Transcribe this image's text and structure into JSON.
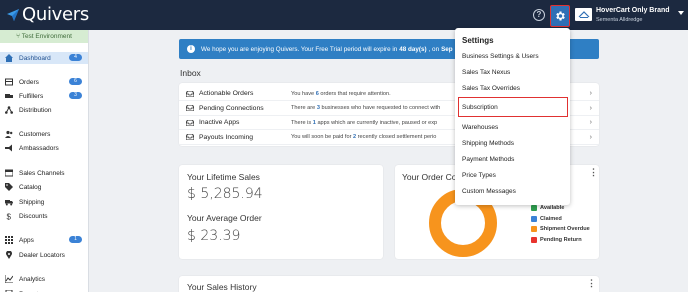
{
  "app": {
    "logo_text": "Quivers",
    "brand_name": "HoverCart Only Brand",
    "user_name": "Sementa Alldredge"
  },
  "sidebar": {
    "environment": "Test Environment",
    "items": [
      {
        "label": "Dashboard",
        "badge": "4",
        "icon": "home-icon",
        "active": true
      },
      {
        "label": "Orders",
        "badge": "6",
        "icon": "orders-icon"
      },
      {
        "label": "Fulfillers",
        "badge": "3",
        "icon": "fulfillers-icon"
      },
      {
        "label": "Distribution",
        "badge": "",
        "icon": "distribution-icon"
      },
      {
        "label": "Customers",
        "badge": "",
        "icon": "customers-icon"
      },
      {
        "label": "Ambassadors",
        "badge": "",
        "icon": "megaphone-icon"
      },
      {
        "label": "Sales Channels",
        "badge": "",
        "icon": "sales-channels-icon"
      },
      {
        "label": "Catalog",
        "badge": "",
        "icon": "tag-icon"
      },
      {
        "label": "Shipping",
        "badge": "",
        "icon": "truck-icon"
      },
      {
        "label": "Discounts",
        "badge": "",
        "icon": "dollar-icon"
      },
      {
        "label": "Apps",
        "badge": "1",
        "icon": "grid-icon"
      },
      {
        "label": "Dealer Locators",
        "badge": "",
        "icon": "map-pin-icon"
      },
      {
        "label": "Analytics",
        "badge": "",
        "icon": "chart-icon"
      },
      {
        "label": "Reports",
        "badge": "",
        "icon": "reports-icon"
      }
    ]
  },
  "banner": {
    "text_before": "We hope you are enjoying Quivers. Your Free Trial period will expire in",
    "days": "48 day(s)",
    "text_after": ", on",
    "date_partial": "Sep"
  },
  "inbox": {
    "title": "Inbox",
    "rows": [
      {
        "label": "Actionable Orders",
        "pre": "You have",
        "num": "6",
        "post": "orders that require attention."
      },
      {
        "label": "Pending Connections",
        "pre": "There are",
        "num": "3",
        "post": "businesses who have requested to connect with"
      },
      {
        "label": "Inactive Apps",
        "pre": "There is",
        "num": "1",
        "post": "apps which are currently inactive, paused or exp"
      },
      {
        "label": "Payouts Incoming",
        "pre": "You will soon be paid for",
        "num": "2",
        "post": "recently closed settlement perio"
      }
    ]
  },
  "lifetime": {
    "title": "Your Lifetime Sales",
    "value": "$ 5,285.94",
    "avg_title": "Your Average Order",
    "avg_value": "$ 23.39"
  },
  "order_card": {
    "title_partial": "Your Order Co",
    "legend": [
      {
        "label": "Available",
        "color": "#2e9e4f"
      },
      {
        "label": "Claimed",
        "color": "#3b82d6"
      },
      {
        "label": "Shipment Overdue",
        "color": "#f7941d"
      },
      {
        "label": "Pending Return",
        "color": "#e8332d"
      }
    ],
    "donut_color": "#f7941d"
  },
  "sales_history": {
    "title": "Your Sales History"
  },
  "settings_menu": {
    "heading": "Settings",
    "items": [
      "Business Settings & Users",
      "Sales Tax Nexus",
      "Sales Tax Overrides",
      "Subscription",
      "Warehouses",
      "Shipping Methods",
      "Payment Methods",
      "Price Types",
      "Custom Messages"
    ],
    "highlighted": "Subscription"
  },
  "colors": {
    "topbar": "#1c2940",
    "accent": "#2f7fc4",
    "highlight_border": "#e03131"
  }
}
